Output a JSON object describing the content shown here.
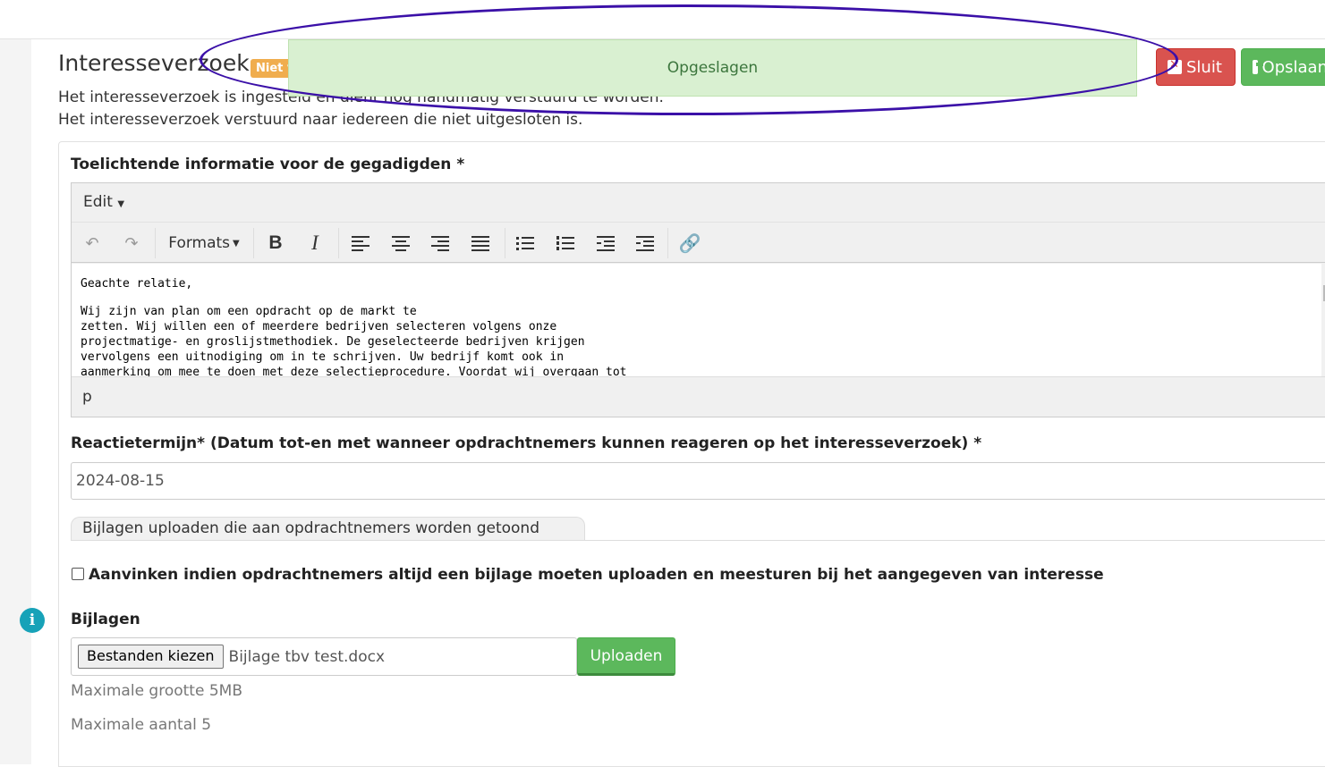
{
  "header": {
    "title": "Interesseverzoek",
    "status_badge": "Niet v",
    "desc_line1": "Het interesseverzoek is ingesteld en dient nog handmatig verstuurd te worden.",
    "desc_line2": "Het interesseverzoek verstuurd naar iedereen die niet uitgesloten is."
  },
  "toast": {
    "message": "Opgeslagen"
  },
  "buttons": {
    "close_label": "Sluit",
    "save_label": "Opslaan"
  },
  "form": {
    "info_label": "Toelichtende informatie voor de gegadigden *",
    "editor": {
      "menu_edit": "Edit",
      "formats": "Formats",
      "content": [
        "Geachte relatie,",
        "Wij zijn van plan om een opdracht op de markt te",
        "zetten. Wij willen een of meerdere bedrijven selecteren volgens onze",
        "projectmatige- en groslijstmethodiek. De geselecteerde bedrijven krijgen",
        "vervolgens een uitnodiging om in te schrijven. Uw bedrijf komt ook in",
        "aanmerking om mee te doen met deze selectieprocedure. Voordat wij overgaan tot"
      ],
      "statusbar_path": "p"
    },
    "reactietermijn_label": "Reactietermijn* (Datum tot-en met wanneer opdrachtnemers kunnen reageren op het interesseverzoek) *",
    "reactietermijn_value": "2024-08-15",
    "tab_label": "Bijlagen uploaden die aan opdrachtnemers worden getoond",
    "checkbox_label": "Aanvinken indien opdrachtnemers altijd een bijlage moeten uploaden en meesturen bij het aangegeven van interesse",
    "checkbox_checked": false,
    "attachments_label": "Bijlagen",
    "file_button": "Bestanden kiezen",
    "file_name": "Bijlage tbv test.docx",
    "upload_button": "Uploaden",
    "max_size": "Maximale grootte 5MB",
    "max_count": "Maximale aantal 5"
  },
  "colors": {
    "toast_bg": "#d9f0d1",
    "danger": "#d9534f",
    "success": "#5cb85c",
    "info": "#17a2b8",
    "annotation": "#3b10a8"
  },
  "icons": [
    "undo-icon",
    "redo-icon",
    "bold-icon",
    "italic-icon",
    "align-left-icon",
    "align-center-icon",
    "align-right-icon",
    "align-justify-icon",
    "bullet-list-icon",
    "numbered-list-icon",
    "outdent-icon",
    "indent-icon",
    "link-icon",
    "info-icon",
    "close-icon",
    "save-icon"
  ]
}
